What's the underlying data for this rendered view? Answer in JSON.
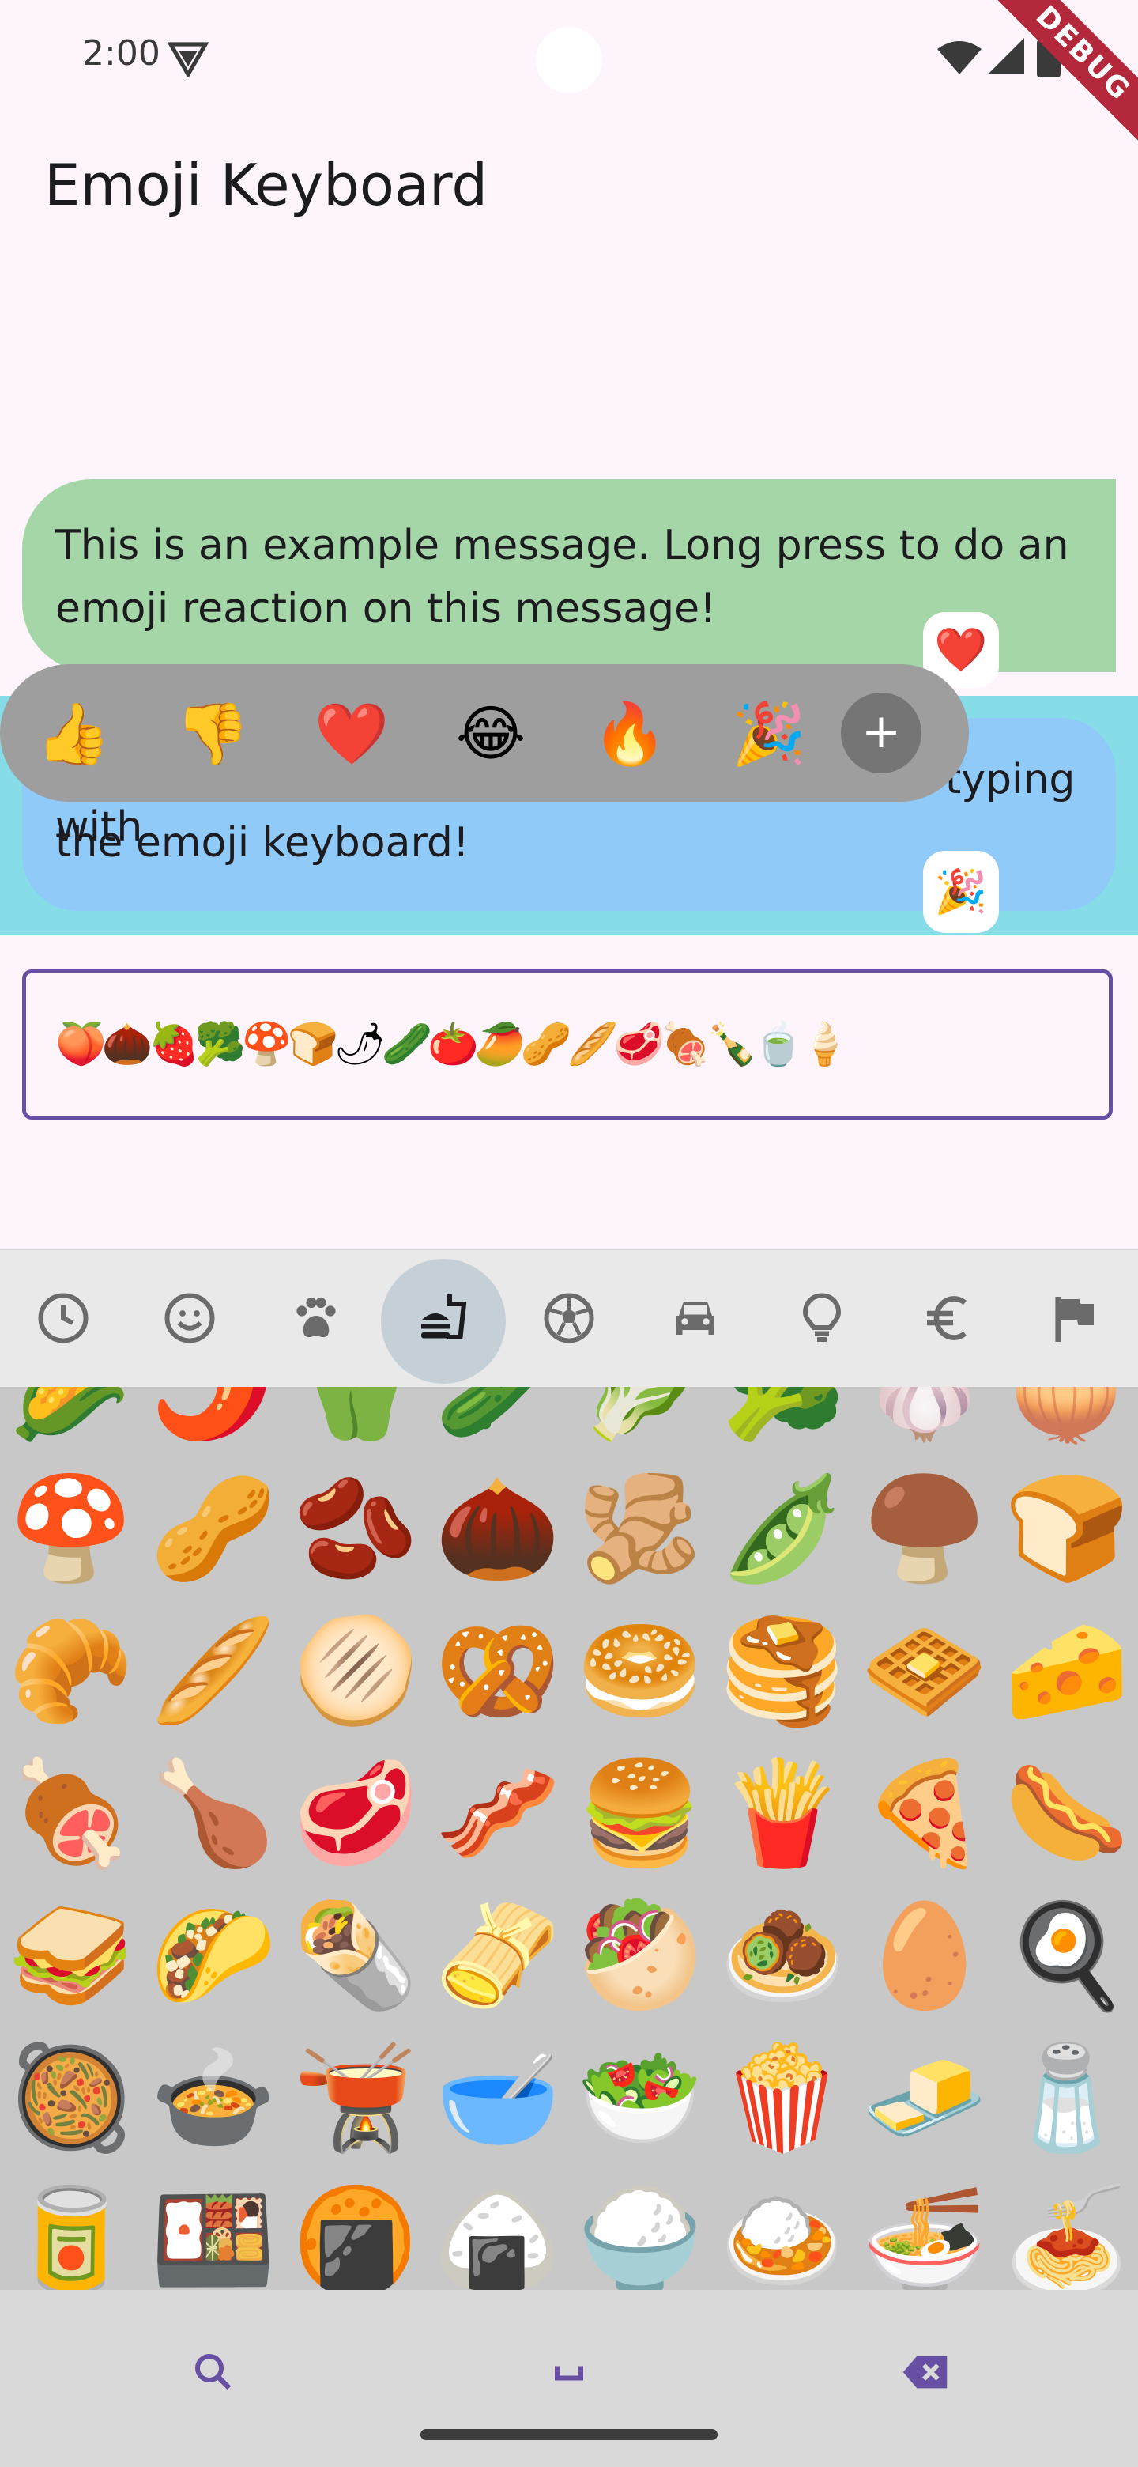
{
  "status_bar": {
    "time": "2:00"
  },
  "debug_banner": "DEBUG",
  "app": {
    "title": "Emoji Keyboard"
  },
  "messages": [
    {
      "text": "This is an example message. Long press to do an emoji reaction on this message!",
      "reaction": "❤️"
    },
    {
      "text_line1": "Long press to do an emoji reaction or start typing with",
      "text_line2": "the emoji keyboard!",
      "reaction": "🎉"
    }
  ],
  "reaction_picker": {
    "emojis": [
      "👍",
      "👎",
      "❤️",
      "😂",
      "🔥",
      "🎉"
    ],
    "add_label": "+"
  },
  "input": {
    "value": "🍑🌰🍓🥦🍄🍞🌶🥒🍅🥭🥜🥖🥩🍖🍾🍵🍦"
  },
  "category_tabs": [
    "recent-icon",
    "smiley-icon",
    "animals-icon",
    "food-icon",
    "activity-icon",
    "travel-icon",
    "objects-icon",
    "symbols-icon",
    "flags-icon"
  ],
  "emoji_grid": [
    [
      "🌽",
      "🌶️",
      "🫑",
      "🥒",
      "🥬",
      "🥦",
      "🧄",
      "🧅"
    ],
    [
      "🍄",
      "🥜",
      "🫘",
      "🌰",
      "🫚",
      "🫛",
      "🍄‍🟫",
      "🍞"
    ],
    [
      "🥐",
      "🥖",
      "🫓",
      "🥨",
      "🥯",
      "🥞",
      "🧇",
      "🧀"
    ],
    [
      "🍖",
      "🍗",
      "🥩",
      "🥓",
      "🍔",
      "🍟",
      "🍕",
      "🌭"
    ],
    [
      "🥪",
      "🌮",
      "🌯",
      "🫔",
      "🥙",
      "🧆",
      "🥚",
      "🍳"
    ],
    [
      "🥘",
      "🍲",
      "🫕",
      "🥣",
      "🥗",
      "🍿",
      "🧈",
      "🧂"
    ],
    [
      "🥫",
      "🍱",
      "🍘",
      "🍙",
      "🍚",
      "🍛",
      "🍜",
      "🍝"
    ]
  ],
  "colors": {
    "accent": "#6750a4",
    "msg1_bg": "#a5d6a7",
    "msg2_bg": "#90caf9"
  }
}
